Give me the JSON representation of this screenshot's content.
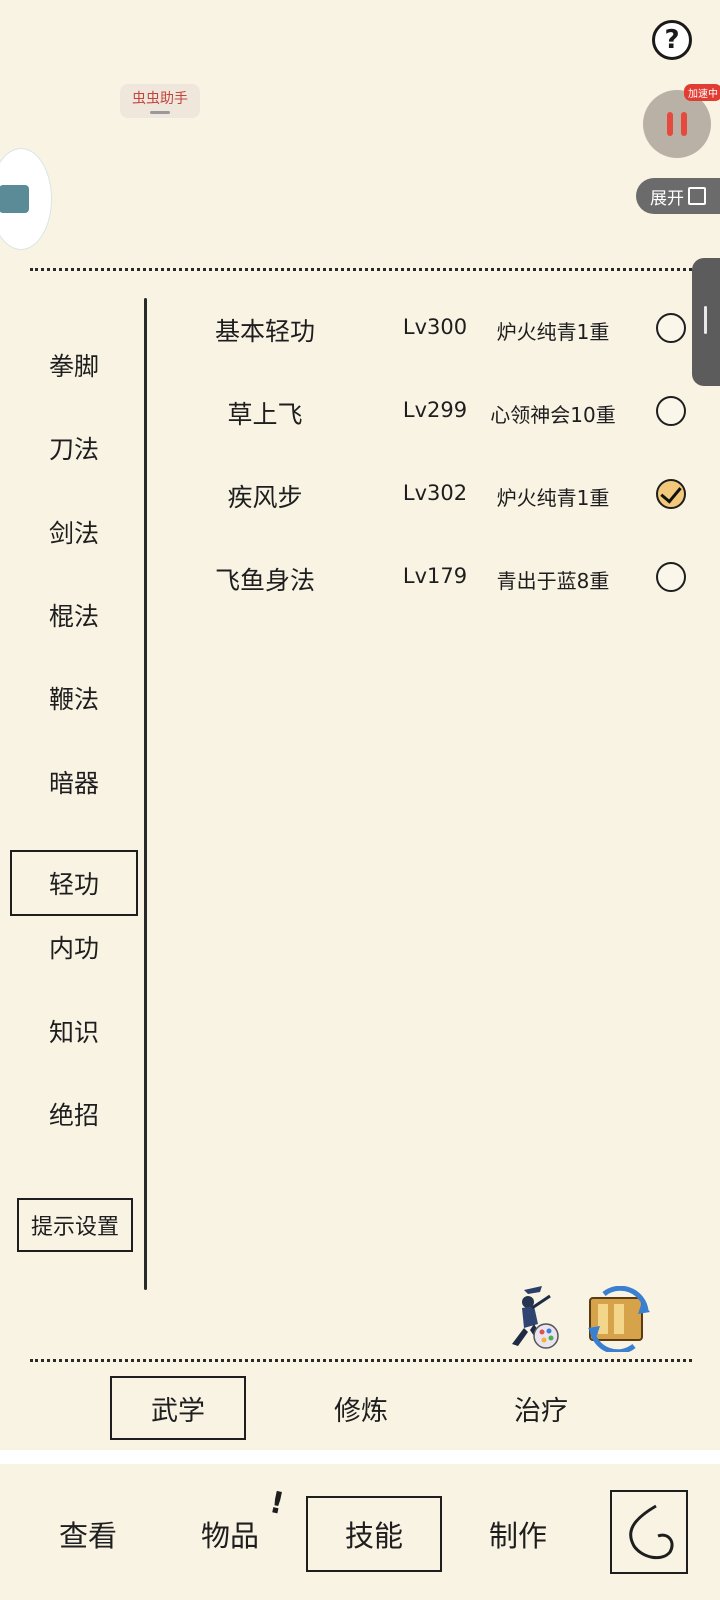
{
  "overlay": {
    "assistant_label": "虫虫助手",
    "speed_badge": "加速中",
    "expand_label": "展开",
    "help_glyph": "?"
  },
  "categories": {
    "items": [
      "拳脚",
      "刀法",
      "剑法",
      "棍法",
      "鞭法",
      "暗器",
      "轻功",
      "内功",
      "知识",
      "绝招"
    ],
    "active": "轻功",
    "hint_settings": "提示设置"
  },
  "skills": [
    {
      "name": "基本轻功",
      "level": "Lv300",
      "rank": "炉火纯青1重",
      "selected": false
    },
    {
      "name": "草上飞",
      "level": "Lv299",
      "rank": "心领神会10重",
      "selected": false
    },
    {
      "name": "疾风步",
      "level": "Lv302",
      "rank": "炉火纯青1重",
      "selected": true
    },
    {
      "name": "飞鱼身法",
      "level": "Lv179",
      "rank": "青出于蓝8重",
      "selected": false
    }
  ],
  "sub_tabs": {
    "martial": "武学",
    "cultivate": "修炼",
    "heal": "治疗",
    "active": "武学"
  },
  "bottom_nav": {
    "view": "查看",
    "items": "物品",
    "skills": "技能",
    "craft": "制作",
    "badge": "!",
    "active": "技能"
  },
  "colors": {
    "background": "#f9f3e4",
    "ink": "#1e1e1e",
    "badge_red": "#e23b32",
    "check_fill": "#f2c97a"
  },
  "icons": [
    "help-icon",
    "pause-icon",
    "expand-icon",
    "martial-art-icon",
    "scroll-swap-icon",
    "back-icon"
  ]
}
